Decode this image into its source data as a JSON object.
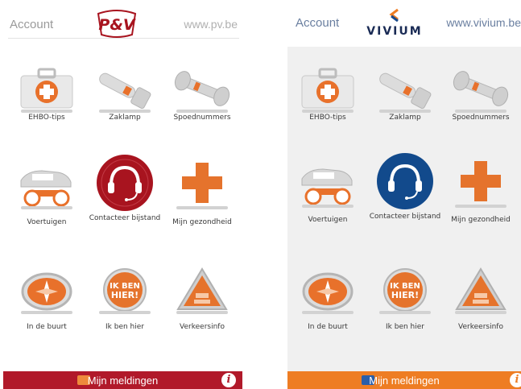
{
  "left": {
    "account": "Account",
    "logo_text": "P&V",
    "url": "www.pv.be",
    "accent": "#b1192a",
    "tiles": [
      {
        "label": "EHBO-tips",
        "icon": "first-aid-kit-icon"
      },
      {
        "label": "Zaklamp",
        "icon": "flashlight-icon"
      },
      {
        "label": "Spoednummers",
        "icon": "phone-handset-icon"
      },
      {
        "label": "Voertuigen",
        "icon": "vehicles-icon"
      },
      {
        "label": "Contacteer bijstand",
        "icon": "headset-icon"
      },
      {
        "label": "Mijn gezondheid",
        "icon": "health-cross-icon"
      },
      {
        "label": "In de buurt",
        "icon": "compass-icon"
      },
      {
        "label": "Ik ben hier",
        "icon": "ik-ben-hier-badge-icon",
        "badge_text": "IK BEN HIER!"
      },
      {
        "label": "Verkeersinfo",
        "icon": "traffic-sign-icon"
      }
    ],
    "bottom": {
      "label": "Mijn meldingen",
      "info": "i"
    }
  },
  "right": {
    "account": "Account",
    "logo_text": "VIVIUM",
    "url": "www.vivium.be",
    "accent": "#ee7d23",
    "brand": "#1a4a8a",
    "tiles": [
      {
        "label": "EHBO-tips",
        "icon": "first-aid-kit-icon"
      },
      {
        "label": "Zaklamp",
        "icon": "flashlight-icon"
      },
      {
        "label": "Spoednummers",
        "icon": "phone-handset-icon"
      },
      {
        "label": "Voertuigen",
        "icon": "vehicles-icon"
      },
      {
        "label": "Contacteer bijstand",
        "icon": "headset-icon"
      },
      {
        "label": "Mijn gezondheid",
        "icon": "health-cross-icon"
      },
      {
        "label": "In de buurt",
        "icon": "compass-icon"
      },
      {
        "label": "Ik ben hier",
        "icon": "ik-ben-hier-badge-icon",
        "badge_text": "IK BEN HIER!"
      },
      {
        "label": "Verkeersinfo",
        "icon": "traffic-sign-icon"
      }
    ],
    "bottom": {
      "label": "Mijn meldingen",
      "info": "i"
    }
  }
}
